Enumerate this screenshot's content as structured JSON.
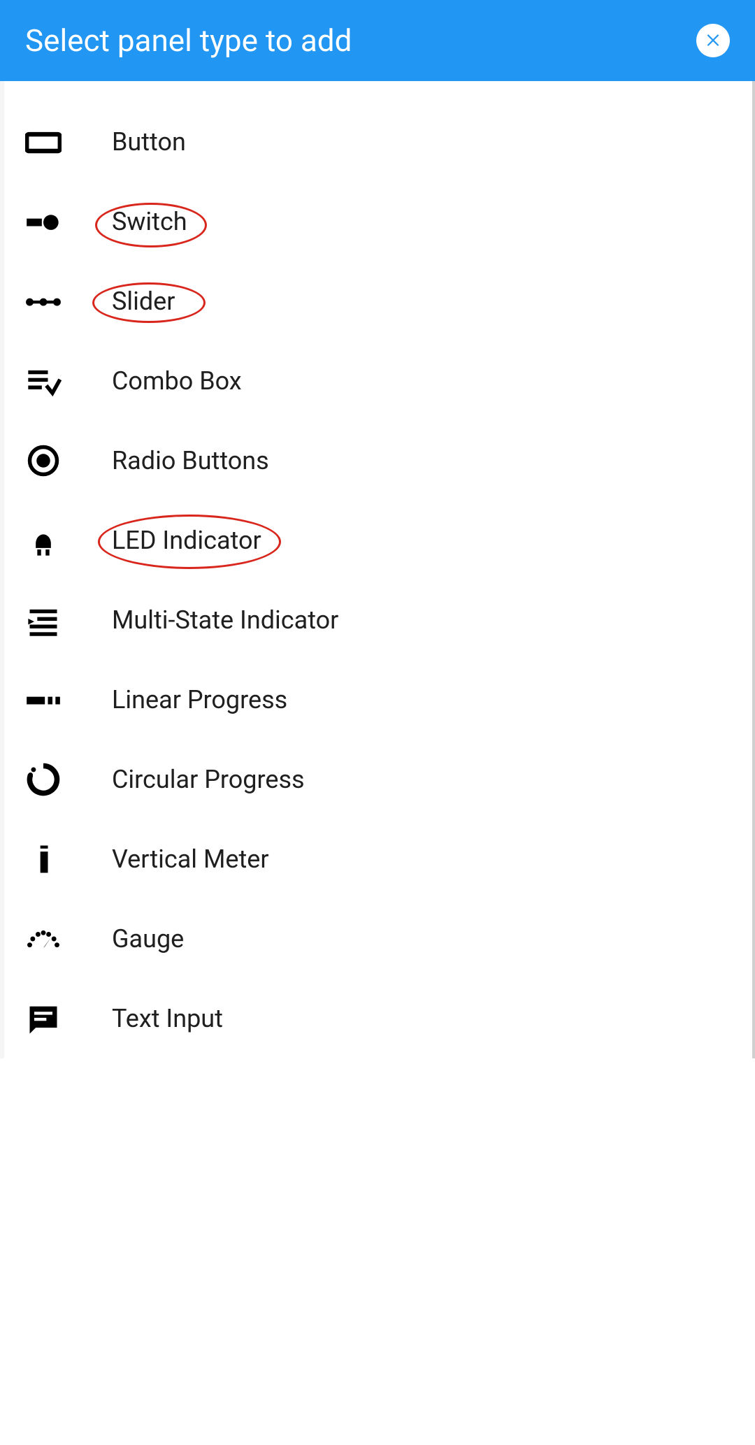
{
  "colors": {
    "accent": "#2196f3",
    "annotation": "#d9261c"
  },
  "header": {
    "title": "Select panel type to add",
    "close_aria": "Close"
  },
  "items": [
    {
      "id": "button",
      "label": "Button",
      "icon": "button-icon",
      "annotated": false
    },
    {
      "id": "switch",
      "label": "Switch",
      "icon": "switch-icon",
      "annotated": true
    },
    {
      "id": "slider",
      "label": "Slider",
      "icon": "slider-icon",
      "annotated": true
    },
    {
      "id": "combo-box",
      "label": "Combo Box",
      "icon": "combo-box-icon",
      "annotated": false
    },
    {
      "id": "radio-buttons",
      "label": "Radio Buttons",
      "icon": "radio-icon",
      "annotated": false
    },
    {
      "id": "led-indicator",
      "label": "LED Indicator",
      "icon": "led-icon",
      "annotated": true
    },
    {
      "id": "multi-state",
      "label": "Multi-State Indicator",
      "icon": "multi-state-icon",
      "annotated": false
    },
    {
      "id": "linear-progress",
      "label": "Linear Progress",
      "icon": "linear-progress-icon",
      "annotated": false
    },
    {
      "id": "circular-progress",
      "label": "Circular Progress",
      "icon": "circular-progress-icon",
      "annotated": false
    },
    {
      "id": "vertical-meter",
      "label": "Vertical Meter",
      "icon": "vertical-meter-icon",
      "annotated": false
    },
    {
      "id": "gauge",
      "label": "Gauge",
      "icon": "gauge-icon",
      "annotated": false
    },
    {
      "id": "text-input",
      "label": "Text Input",
      "icon": "text-input-icon",
      "annotated": false
    }
  ]
}
